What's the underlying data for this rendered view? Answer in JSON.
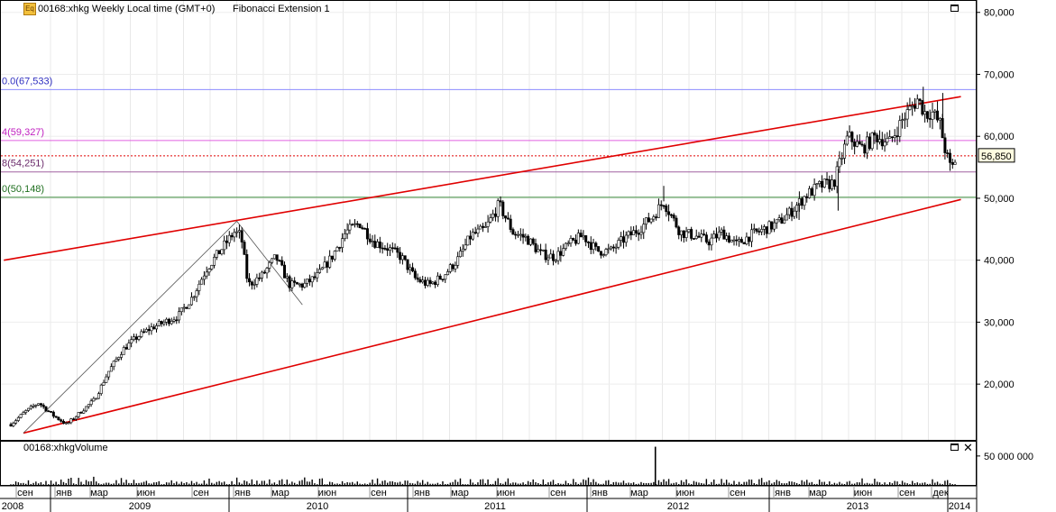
{
  "window": {
    "symbol_title": "00168:xhkg Weekly Local time (GMT+0)",
    "indicator_title": "Fibonacci Extension 1",
    "icon": "eq-icon",
    "volume_title": "00168:xhkgVolume"
  },
  "chart_data": [
    {
      "type": "candlestick",
      "title": "00168:xhkg Weekly Local time (GMT+0)",
      "ylim": [
        11000,
        82000
      ],
      "y_ticks": [
        "20,000",
        "30,000",
        "40,000",
        "50,000",
        "60,000",
        "70,000",
        "80,000"
      ],
      "y_tick_values": [
        20000,
        30000,
        40000,
        50000,
        60000,
        70000,
        80000
      ],
      "current_price_label": "56,850",
      "current_price": 56850,
      "fibonacci_levels": [
        {
          "label": "0.0(67,533)",
          "value": 67533,
          "color": "#8c8cff"
        },
        {
          "label": "4(59,327)",
          "value": 59327,
          "color": "#e060e0"
        },
        {
          "label": "8(54,251)",
          "value": 54251,
          "color": "#a060a0"
        },
        {
          "label": "0(50,148)",
          "value": 50148,
          "color": "#3c8c3c"
        }
      ],
      "trend_channel": {
        "color": "#e00000",
        "upper": [
          [
            -0.5,
            40000
          ],
          [
            68.1,
            66400
          ]
        ],
        "lower": [
          [
            0.9,
            12100
          ],
          [
            68.1,
            49800
          ]
        ]
      },
      "fib_guide_points": [
        [
          0.9,
          12100
        ],
        [
          16.2,
          46300
        ],
        [
          20.9,
          32800
        ]
      ],
      "price_path": [
        [
          0,
          13500
        ],
        [
          1,
          15500
        ],
        [
          2,
          17000
        ],
        [
          3,
          15000
        ],
        [
          4,
          13500
        ],
        [
          5,
          15500
        ],
        [
          6,
          17500
        ],
        [
          7,
          22000
        ],
        [
          8,
          25500
        ],
        [
          9,
          27500
        ],
        [
          10,
          29000
        ],
        [
          11,
          30000
        ],
        [
          12,
          31000
        ],
        [
          13,
          34000
        ],
        [
          14,
          38500
        ],
        [
          15,
          41500
        ],
        [
          16,
          44500
        ],
        [
          16.5,
          44000
        ],
        [
          17,
          36000
        ],
        [
          18,
          37500
        ],
        [
          19,
          40500
        ],
        [
          20,
          36000
        ],
        [
          21,
          36000
        ],
        [
          22,
          37500
        ],
        [
          23,
          40500
        ],
        [
          24,
          44500
        ],
        [
          25,
          46000
        ],
        [
          26,
          43000
        ],
        [
          27,
          42000
        ],
        [
          28,
          40500
        ],
        [
          29,
          37000
        ],
        [
          30,
          36000
        ],
        [
          31,
          37500
        ],
        [
          32,
          40000
        ],
        [
          33,
          44000
        ],
        [
          34,
          45000
        ],
        [
          35,
          49000
        ],
        [
          36,
          44500
        ],
        [
          37,
          43500
        ],
        [
          38,
          41000
        ],
        [
          39,
          40500
        ],
        [
          40,
          42500
        ],
        [
          41,
          44000
        ],
        [
          42,
          41500
        ],
        [
          43,
          41500
        ],
        [
          44,
          43500
        ],
        [
          45,
          45000
        ],
        [
          46,
          47000
        ],
        [
          46.8,
          49500
        ],
        [
          47.5,
          46500
        ],
        [
          48,
          44500
        ],
        [
          49,
          44000
        ],
        [
          50,
          43000
        ],
        [
          51,
          44500
        ],
        [
          52,
          42500
        ],
        [
          53,
          44000
        ],
        [
          54,
          45000
        ],
        [
          55,
          46000
        ],
        [
          56,
          48000
        ],
        [
          57,
          50500
        ],
        [
          58,
          52000
        ],
        [
          59,
          52500
        ],
        [
          60,
          60000
        ],
        [
          61,
          58000
        ],
        [
          62,
          60000
        ],
        [
          63,
          59000
        ],
        [
          64,
          63000
        ],
        [
          65,
          66000
        ],
        [
          65.6,
          63500
        ],
        [
          66,
          64000
        ],
        [
          66.6,
          62000
        ],
        [
          67,
          57500
        ],
        [
          67.4,
          54500
        ],
        [
          67.8,
          56850
        ]
      ],
      "spikes": [
        [
          59.3,
          48000
        ],
        [
          56.5,
          46500
        ],
        [
          46.8,
          52000
        ],
        [
          65.4,
          68000
        ],
        [
          66.8,
          67000
        ]
      ],
      "x_month_labels": [
        "сен",
        "янв",
        "мар",
        "июн",
        "сен",
        "янв",
        "мар",
        "июн",
        "сен",
        "янв",
        "мар",
        "июн",
        "сен",
        "янв",
        "мар",
        "июн",
        "сен",
        "янв",
        "мар",
        "июн",
        "сен",
        "дек"
      ],
      "x_year_labels": [
        "2008",
        "2009",
        "2010",
        "2011",
        "2012",
        "2013",
        "2014"
      ]
    },
    {
      "type": "bar",
      "title": "00168:xhkgVolume",
      "y_ticks": [
        "50 000 000"
      ],
      "y_tick_values": [
        50000000
      ],
      "ylim": [
        0,
        70000000
      ],
      "spike": {
        "x": 46.2,
        "value": 66000000
      }
    }
  ]
}
